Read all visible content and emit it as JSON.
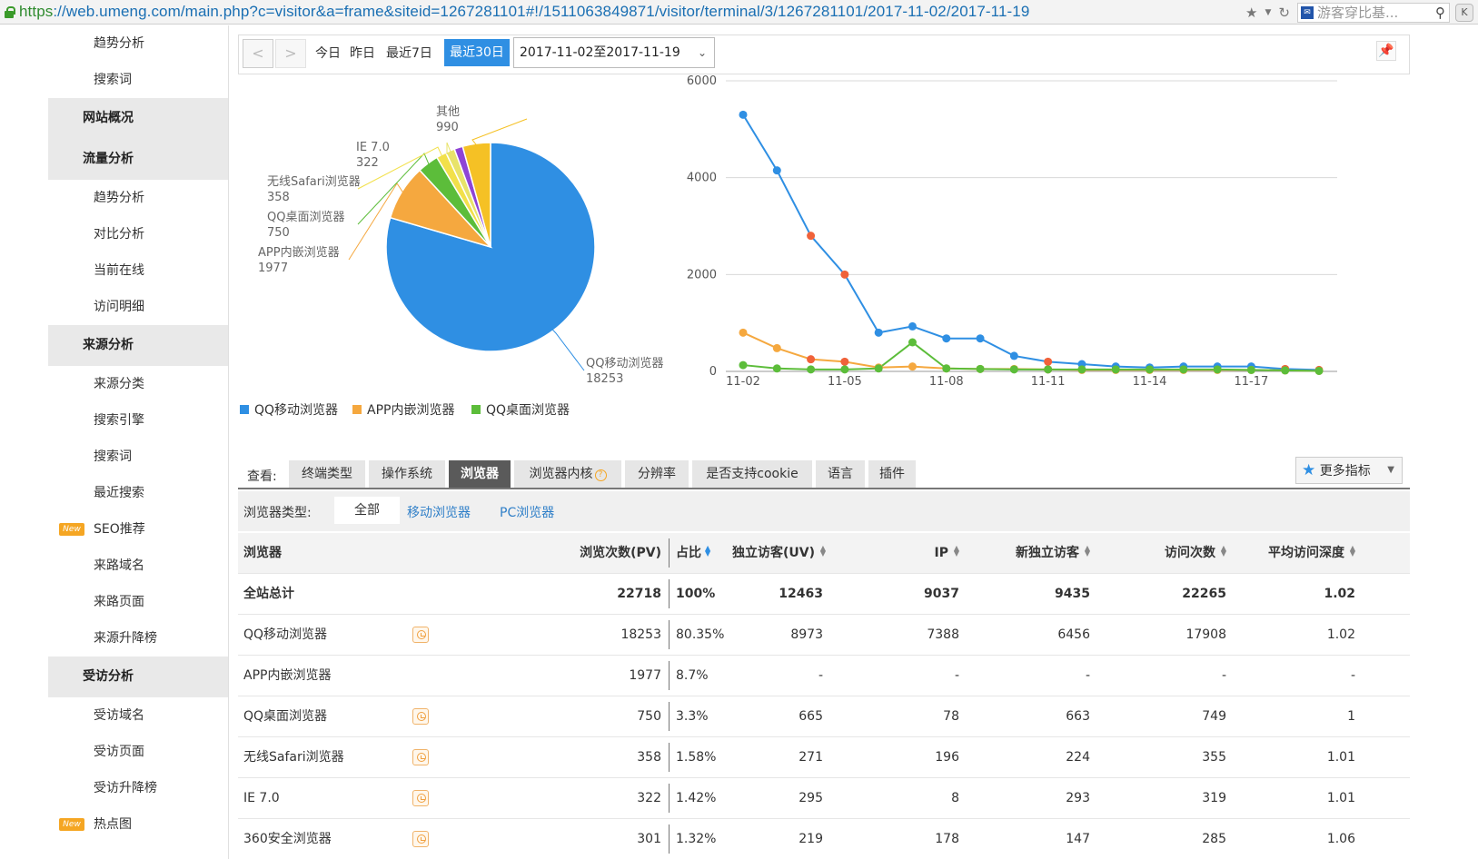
{
  "browser": {
    "url_scheme": "https",
    "url_rest": "://web.umeng.com/main.php?c=visitor&a=frame&siteid=1267281101#!/1511063849871/visitor/terminal/3/1267281101/2017-11-02/2017-11-19",
    "search_text": "游客穿比基..."
  },
  "sidebar": {
    "items": [
      {
        "type": "item",
        "label": "趋势分析"
      },
      {
        "type": "item",
        "label": "搜索词"
      },
      {
        "type": "head",
        "label": "网站概况"
      },
      {
        "type": "head",
        "label": "流量分析"
      },
      {
        "type": "item",
        "label": "趋势分析"
      },
      {
        "type": "item",
        "label": "对比分析"
      },
      {
        "type": "item",
        "label": "当前在线"
      },
      {
        "type": "item",
        "label": "访问明细"
      },
      {
        "type": "head",
        "label": "来源分析"
      },
      {
        "type": "item",
        "label": "来源分类"
      },
      {
        "type": "item",
        "label": "搜索引擎"
      },
      {
        "type": "item",
        "label": "搜索词"
      },
      {
        "type": "item",
        "label": "最近搜索"
      },
      {
        "type": "item",
        "label": "SEO推荐",
        "badge": "New"
      },
      {
        "type": "item",
        "label": "来路域名"
      },
      {
        "type": "item",
        "label": "来路页面"
      },
      {
        "type": "item",
        "label": "来源升降榜"
      },
      {
        "type": "head",
        "label": "受访分析"
      },
      {
        "type": "item",
        "label": "受访域名"
      },
      {
        "type": "item",
        "label": "受访页面"
      },
      {
        "type": "item",
        "label": "受访升降榜"
      },
      {
        "type": "item",
        "label": "热点图",
        "badge": "New"
      }
    ]
  },
  "toolbar": {
    "prev": "<",
    "next": ">",
    "today": "今日",
    "yesterday": "昨日",
    "last7": "最近7日",
    "last30": "最近30日",
    "date_range": "2017-11-02至2017-11-19"
  },
  "colors": {
    "blue": "#2f8fe3",
    "orange": "#f5a83f",
    "green": "#5cbd3a",
    "yellow": "#f2e04a",
    "purple": "#8e44d6",
    "gold": "#f5c125",
    "red_point": "#f0623a"
  },
  "chart_data": [
    {
      "type": "pie",
      "slices": [
        {
          "label": "QQ移动浏览器",
          "value": 18253
        },
        {
          "label": "APP内嵌浏览器",
          "value": 1977
        },
        {
          "label": "QQ桌面浏览器",
          "value": 750
        },
        {
          "label": "无线Safari浏览器",
          "value": 358
        },
        {
          "label": "IE 7.0",
          "value": 322
        },
        {
          "label": "",
          "value": 301
        },
        {
          "label": "其他",
          "value": 990
        }
      ],
      "legend": [
        "QQ移动浏览器",
        "APP内嵌浏览器",
        "QQ桌面浏览器"
      ],
      "legend_placement": "bottom-left"
    },
    {
      "type": "line",
      "x": [
        "11-02",
        "11-03",
        "11-04",
        "11-05",
        "11-06",
        "11-07",
        "11-08",
        "11-09",
        "11-10",
        "11-11",
        "11-12",
        "11-13",
        "11-14",
        "11-15",
        "11-16",
        "11-17",
        "11-18",
        "11-19"
      ],
      "xticks": [
        "11-02",
        "11-05",
        "11-08",
        "11-11",
        "11-14",
        "11-17"
      ],
      "yticks": [
        "0",
        "2000",
        "4000",
        "6000"
      ],
      "ylim": [
        0,
        6000
      ],
      "grid": true,
      "series": [
        {
          "name": "QQ移动浏览器",
          "values": [
            5300,
            4150,
            2800,
            2000,
            800,
            930,
            680,
            680,
            320,
            200,
            150,
            100,
            80,
            100,
            100,
            100,
            50,
            30
          ]
        },
        {
          "name": "APP内嵌浏览器",
          "values": [
            800,
            480,
            250,
            200,
            80,
            100,
            60,
            50,
            50,
            40,
            30,
            30,
            30,
            30,
            30,
            30,
            20,
            10
          ]
        },
        {
          "name": "QQ桌面浏览器",
          "values": [
            130,
            60,
            40,
            40,
            60,
            600,
            60,
            50,
            40,
            40,
            40,
            40,
            40,
            40,
            40,
            30,
            20,
            10
          ]
        }
      ]
    }
  ],
  "tabs": {
    "view_label": "查看:",
    "items": [
      "终端类型",
      "操作系统",
      "浏览器",
      "浏览器内核",
      "分辨率",
      "是否支持cookie",
      "语言",
      "插件"
    ],
    "active": "浏览器",
    "more": "更多指标"
  },
  "filter": {
    "label": "浏览器类型:",
    "all": "全部",
    "mobile": "移动浏览器",
    "pc": "PC浏览器"
  },
  "table": {
    "headers": [
      "浏览器",
      "浏览次数(PV)",
      "占比",
      "独立访客(UV)",
      "IP",
      "新独立访客",
      "访问次数",
      "平均访问深度"
    ],
    "total": [
      "全站总计",
      "22718",
      "100%",
      "12463",
      "9037",
      "9435",
      "22265",
      "1.02"
    ],
    "rows": [
      {
        "cells": [
          "QQ移动浏览器",
          "18253",
          "80.35%",
          "8973",
          "7388",
          "6456",
          "17908",
          "1.02"
        ],
        "trend": true
      },
      {
        "cells": [
          "APP内嵌浏览器",
          "1977",
          "8.7%",
          "-",
          "-",
          "-",
          "-",
          "-"
        ],
        "trend": false
      },
      {
        "cells": [
          "QQ桌面浏览器",
          "750",
          "3.3%",
          "665",
          "78",
          "663",
          "749",
          "1"
        ],
        "trend": true
      },
      {
        "cells": [
          "无线Safari浏览器",
          "358",
          "1.58%",
          "271",
          "196",
          "224",
          "355",
          "1.01"
        ],
        "trend": true
      },
      {
        "cells": [
          "IE 7.0",
          "322",
          "1.42%",
          "295",
          "8",
          "293",
          "319",
          "1.01"
        ],
        "trend": true
      },
      {
        "cells": [
          "360安全浏览器",
          "301",
          "1.32%",
          "219",
          "178",
          "147",
          "285",
          "1.06"
        ],
        "trend": true
      }
    ]
  }
}
